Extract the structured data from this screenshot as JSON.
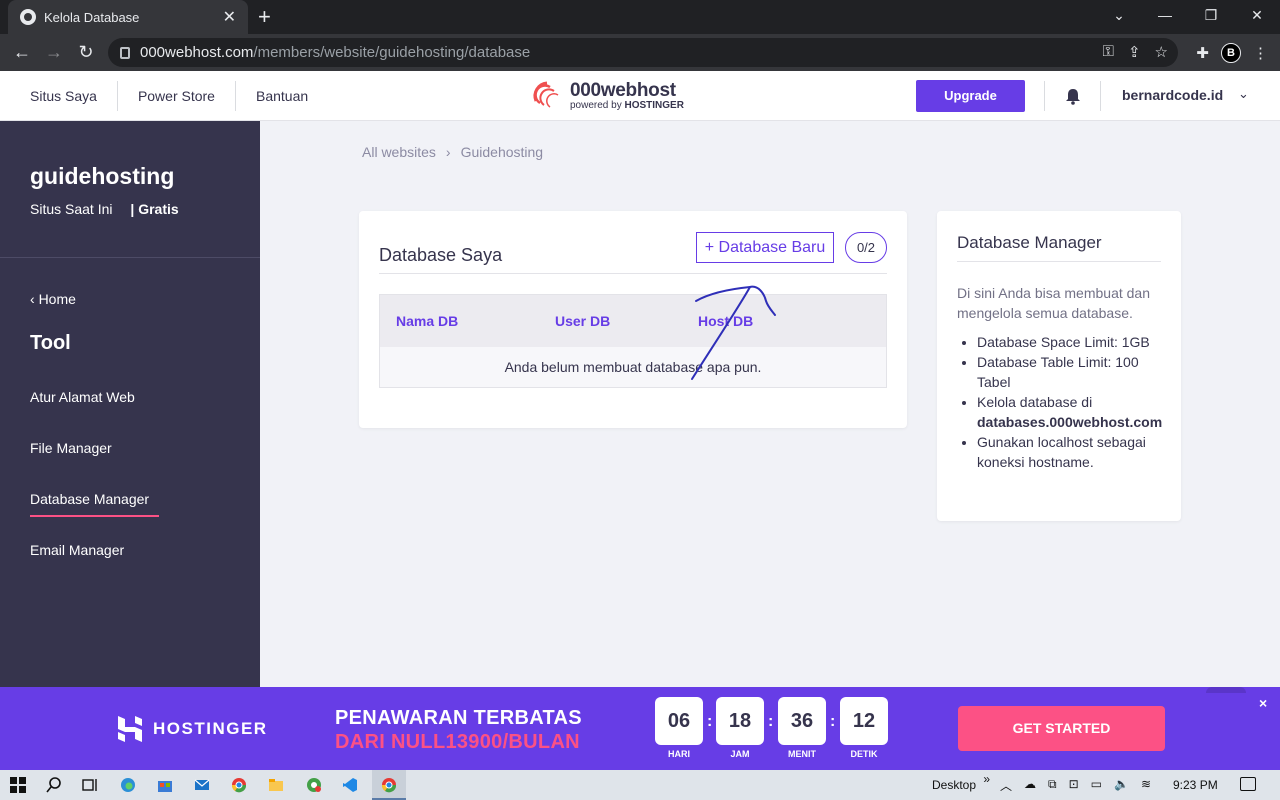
{
  "browser": {
    "tab_title": "Kelola Database",
    "url_host": "000webhost.com",
    "url_path": "/members/website/guidehosting/database"
  },
  "header": {
    "nav": [
      "Situs Saya",
      "Power Store",
      "Bantuan"
    ],
    "logo_main": "000webhost",
    "logo_sub_prefix": "powered by",
    "logo_sub_brand": "HOSTINGER",
    "upgrade_label": "Upgrade",
    "account_name": "bernardcode.id"
  },
  "sidebar": {
    "site_name": "guidehosting",
    "site_status": "Situs Saat Ini",
    "site_plan": "| Gratis",
    "home_label": "Home",
    "tool_title": "Tool",
    "items": [
      {
        "label": "Atur Alamat Web"
      },
      {
        "label": "File Manager"
      },
      {
        "label": "Database Manager",
        "active": true
      },
      {
        "label": "Email Manager"
      }
    ]
  },
  "breadcrumb": {
    "root": "All websites",
    "separator": "›",
    "current": "Guidehosting"
  },
  "main": {
    "title": "Database Saya",
    "new_db_label": "+ Database Baru",
    "count": "0/2",
    "columns": [
      "Nama DB",
      "User DB",
      "Host DB"
    ],
    "empty_message": "Anda belum membuat database apa pun."
  },
  "info": {
    "title": "Database Manager",
    "description": "Di sini Anda bisa membuat dan mengelola semua database.",
    "bullets": {
      "space": "Database Space Limit: 1GB",
      "table": "Database Table Limit: 100 Tabel",
      "manage_prefix": "Kelola database di",
      "manage_host": "databases.000webhost.com",
      "localhost": "Gunakan localhost sebagai koneksi hostname."
    }
  },
  "promo": {
    "brand": "HOSTINGER",
    "headline": "PENAWARAN TERBATAS",
    "subline": "DARI NULL13900/BULAN",
    "timer": [
      {
        "value": "06",
        "label": "HARI"
      },
      {
        "value": "18",
        "label": "JAM"
      },
      {
        "value": "36",
        "label": "MENIT"
      },
      {
        "value": "12",
        "label": "DETIK"
      }
    ],
    "cta": "GET STARTED",
    "close": "×"
  },
  "taskbar": {
    "desktop_label": "Desktop",
    "chevron": "»",
    "time": "9:23 PM"
  },
  "colors": {
    "accent_purple": "#673de6",
    "sidebar_bg": "#36344d",
    "promo_pink": "#fc5185"
  }
}
